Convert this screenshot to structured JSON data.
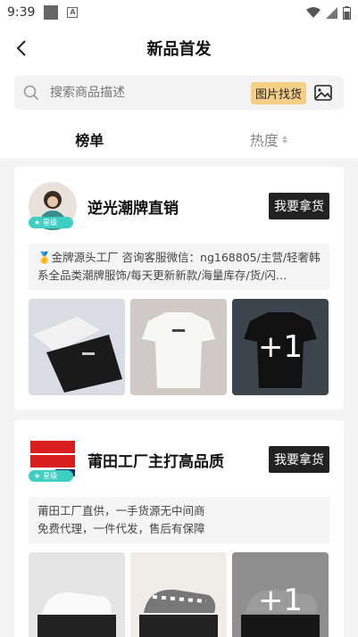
{
  "status_bar": {
    "time": "9:39"
  },
  "header": {
    "title": "新品首发"
  },
  "search": {
    "placeholder": "搜索商品描述",
    "image_search_label": "图片找货"
  },
  "tabs": [
    {
      "label": "榜单"
    },
    {
      "label": "热度"
    }
  ],
  "cards": [
    {
      "shop_name": "逆光潮牌直销",
      "badge": "星级",
      "button": "我要拿货",
      "description": "🥇金牌源头工厂 咨询客服微信：ng168805/主营/轻奢韩系全品类潮牌服饰/每天更新新款/海量库存/货/闪…",
      "more_count": "+1"
    },
    {
      "shop_name": "莆田工厂主打高品质",
      "badge": "星级",
      "button": "我要拿货",
      "description": "莆田工厂直供，一手货源无中间商\n免费代理，一件代发，售后有保障",
      "more_count": "+1"
    }
  ],
  "colors": {
    "accent_tag": "#f5cf86",
    "badge": "#3fcfc2",
    "button": "#222222"
  }
}
